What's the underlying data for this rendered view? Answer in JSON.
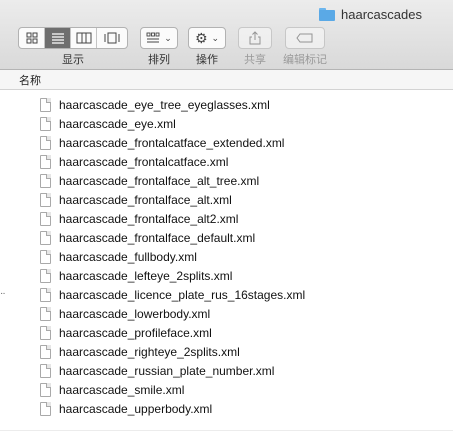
{
  "window": {
    "title": "haarcascades"
  },
  "toolbar": {
    "view_label": "显示",
    "arrange_label": "排列",
    "action_label": "操作",
    "share_label": "共享",
    "tags_label": "编辑标记"
  },
  "list_header": {
    "name_column": "名称"
  },
  "files": [
    "haarcascade_eye_tree_eyeglasses.xml",
    "haarcascade_eye.xml",
    "haarcascade_frontalcatface_extended.xml",
    "haarcascade_frontalcatface.xml",
    "haarcascade_frontalface_alt_tree.xml",
    "haarcascade_frontalface_alt.xml",
    "haarcascade_frontalface_alt2.xml",
    "haarcascade_frontalface_default.xml",
    "haarcascade_fullbody.xml",
    "haarcascade_lefteye_2splits.xml",
    "haarcascade_licence_plate_rus_16stages.xml",
    "haarcascade_lowerbody.xml",
    "haarcascade_profileface.xml",
    "haarcascade_righteye_2splits.xml",
    "haarcascade_russian_plate_number.xml",
    "haarcascade_smile.xml",
    "haarcascade_upperbody.xml"
  ],
  "colors": {
    "folder_blue": "#5aa9e6",
    "active_segment": "#6f6f6f"
  }
}
